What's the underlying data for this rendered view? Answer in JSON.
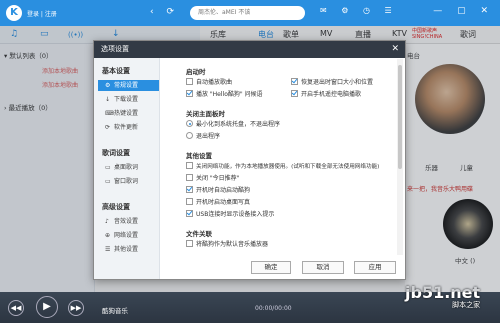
{
  "app": {
    "logo": "K",
    "login": "登录 | 注册",
    "nav_back": "‹",
    "nav_refresh": "⟳",
    "search_placeholder": "周杰伦、aMEI 不该",
    "win_icons": "✉ ⚙ ◷ ☰",
    "win_controls": "— ▢ ✕"
  },
  "toolrow": {
    "icons": [
      "♫",
      "▭",
      "((•))",
      "↓"
    ]
  },
  "nav_tabs": [
    {
      "label": "乐库",
      "active": false
    },
    {
      "label": "电台",
      "active": true
    },
    {
      "label": "歌单",
      "active": false
    },
    {
      "label": "MV",
      "active": false
    },
    {
      "label": "直播",
      "active": false
    },
    {
      "label": "KTV",
      "active": false
    },
    {
      "label": "歌词",
      "active": false
    }
  ],
  "nav_brand": "中国新歌声 SING!CHINA",
  "left_panel": {
    "default_list": "▾ 默认列表（0）",
    "add_local": [
      "添加本地歌曲",
      "添加本地歌曲"
    ],
    "recent": "› 最近播放（0）"
  },
  "right_content": {
    "subtitle": "电台",
    "tags": [
      "乐器",
      "儿童"
    ],
    "promo": "来一把，我音乐大鸭用碟",
    "chinese_label": "中文 ()"
  },
  "player": {
    "song": "酷狗音乐",
    "time": "00:00/00:00"
  },
  "watermark": {
    "main": "jb51.net",
    "sub": "脚本之家"
  },
  "dialog": {
    "title": "选项设置",
    "close": "✕",
    "sidebar": [
      {
        "group": "基本设置",
        "items": [
          {
            "icon": "⚙",
            "label": "常规设置",
            "active": true
          },
          {
            "icon": "↓",
            "label": "下载设置",
            "active": false
          },
          {
            "icon": "⌨",
            "label": "热键设置",
            "active": false
          },
          {
            "icon": "⟳",
            "label": "软件更新",
            "active": false
          }
        ]
      },
      {
        "group": "歌词设置",
        "items": [
          {
            "icon": "▭",
            "label": "桌面歌词",
            "active": false
          },
          {
            "icon": "▭",
            "label": "窗口歌词",
            "active": false
          }
        ]
      },
      {
        "group": "高级设置",
        "items": [
          {
            "icon": "♪",
            "label": "音效设置",
            "active": false
          },
          {
            "icon": "⊕",
            "label": "网络设置",
            "active": false
          },
          {
            "icon": "☰",
            "label": "其他设置",
            "active": false
          }
        ]
      }
    ],
    "sections": {
      "startup": {
        "title": "启动时",
        "options": [
          {
            "label": "自动播放歌曲",
            "checked": false
          },
          {
            "label": "恢复退出时窗口大小和位置",
            "checked": true
          },
          {
            "label": "播放 \"Hello酷狗\" 问候语",
            "checked": true
          },
          {
            "label": "开启手机遥控电脑播歌",
            "checked": true
          }
        ]
      },
      "close_panel": {
        "title": "关闭主面板时",
        "options": [
          {
            "label": "最小化到系统托盘，不退出程序",
            "selected": true
          },
          {
            "label": "退出程序",
            "selected": false
          }
        ]
      },
      "other": {
        "title": "其他设置",
        "options": [
          {
            "label": "关闭网络功能，作为本地播放器使用。(试听和下载全部无法使用网络功能)",
            "checked": false
          },
          {
            "label": "关闭 \"今日推荐\"",
            "checked": false
          },
          {
            "label": "开机时自动启动酷狗",
            "checked": true
          },
          {
            "label": "开机时启动桌面写真",
            "checked": false
          },
          {
            "label": "USB连接时显示设备接入提示",
            "checked": true
          }
        ]
      },
      "file_assoc": {
        "title": "文件关联",
        "options": [
          {
            "label": "将酷狗作为默认音乐播放器",
            "checked": false
          }
        ]
      }
    },
    "buttons": {
      "ok": "确定",
      "cancel": "取消",
      "apply": "应用"
    }
  }
}
